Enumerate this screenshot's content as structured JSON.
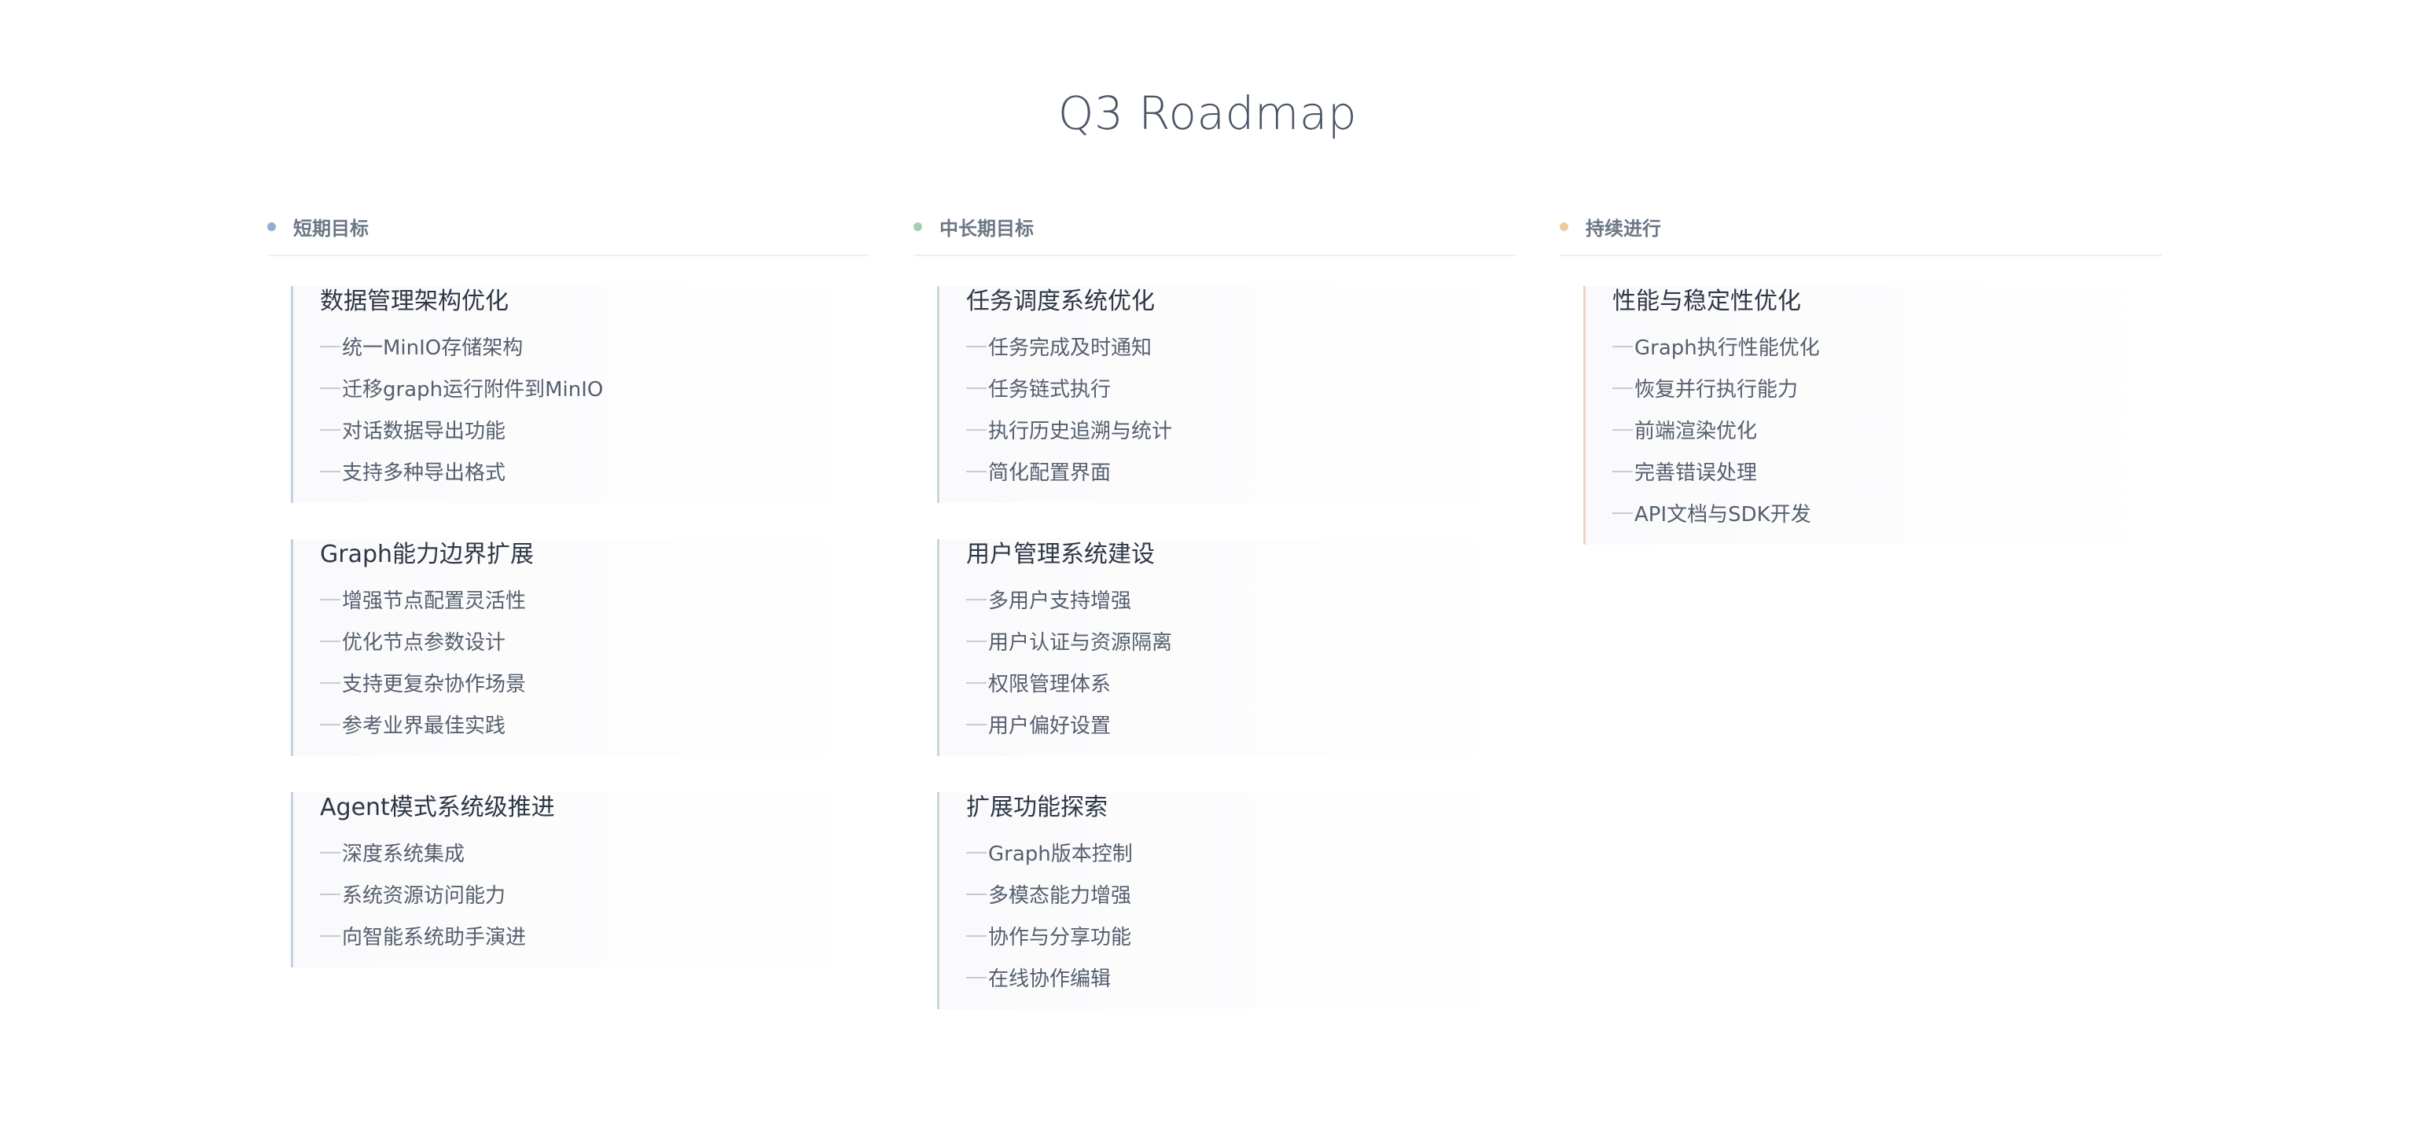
{
  "title": "Q3 Roadmap",
  "columns": [
    {
      "label": "短期目标",
      "color": "#94abd3",
      "line_color": "#c5d0e2",
      "sections": [
        {
          "title": "数据管理架构优化",
          "items": [
            "统一MinIO存储架构",
            "迁移graph运行附件到MinIO",
            "对话数据导出功能",
            "支持多种导出格式"
          ]
        },
        {
          "title": "Graph能力边界扩展",
          "items": [
            "增强节点配置灵活性",
            "优化节点参数设计",
            "支持更复杂协作场景",
            "参考业界最佳实践"
          ]
        },
        {
          "title": "Agent模式系统级推进",
          "items": [
            "深度系统集成",
            "系统资源访问能力",
            "向智能系统助手演进"
          ]
        }
      ]
    },
    {
      "label": "中长期目标",
      "color": "#a6cfb1",
      "line_color": "#c2ddc7",
      "sections": [
        {
          "title": "任务调度系统优化",
          "items": [
            "任务完成及时通知",
            "任务链式执行",
            "执行历史追溯与统计",
            "简化配置界面"
          ]
        },
        {
          "title": "用户管理系统建设",
          "items": [
            "多用户支持增强",
            "用户认证与资源隔离",
            "权限管理体系",
            "用户偏好设置"
          ]
        },
        {
          "title": "扩展功能探索",
          "items": [
            "Graph版本控制",
            "多模态能力增强",
            "协作与分享功能",
            "在线协作编辑"
          ]
        }
      ]
    },
    {
      "label": "持续进行",
      "color": "#f0c99a",
      "line_color": "#eed7bc",
      "sections": [
        {
          "title": "性能与稳定性优化",
          "items": [
            "Graph执行性能优化",
            "恢复并行执行能力",
            "前端渲染优化",
            "完善错误处理",
            "API文档与SDK开发"
          ]
        }
      ]
    }
  ]
}
